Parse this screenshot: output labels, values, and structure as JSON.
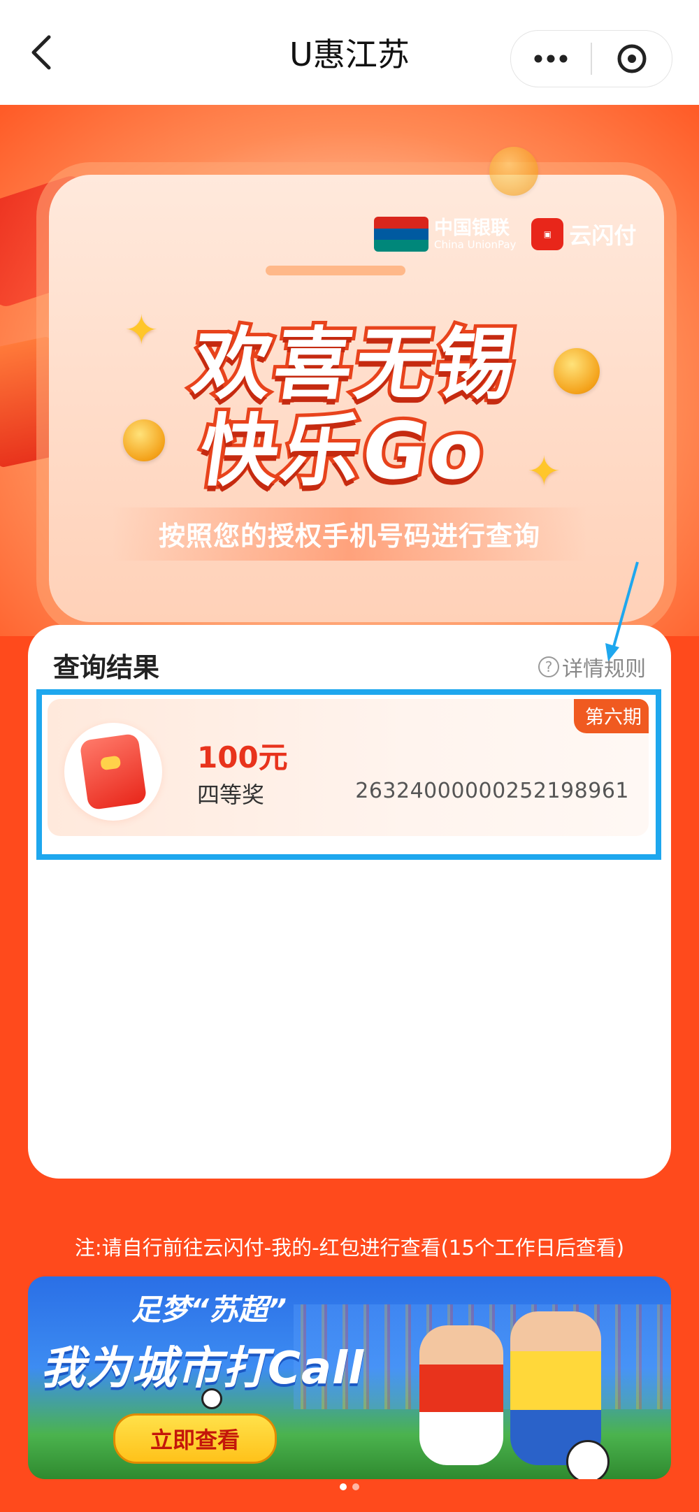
{
  "nav": {
    "title": "U惠江苏",
    "back_icon": "chevron-left-icon",
    "more_icon": "more-dots-icon",
    "close_icon": "close-circle-icon"
  },
  "banner": {
    "logo_unionpay_cn": "中国银联",
    "logo_unionpay_en": "China UnionPay",
    "logo_ysf": "云闪付",
    "headline_line1": "欢喜无锡",
    "headline_line2": "快乐Go",
    "subtitle": "按照您的授权手机号码进行查询"
  },
  "result": {
    "title": "查询结果",
    "rules_label": "详情规则",
    "items": [
      {
        "period": "第六期",
        "amount": "100元",
        "level": "四等奖",
        "code": "26324000000252198961"
      }
    ]
  },
  "note": "注:请自行前往云闪付-我的-红包进行查看(15个工作日后查看)",
  "promo": {
    "tag": "足梦“苏超”",
    "title": "我为城市打Call",
    "cta": "立即查看"
  },
  "carousel": {
    "count": 2,
    "active_index": 0
  },
  "colors": {
    "accent_red": "#ff4a1c",
    "prize_red": "#e8331c",
    "highlight_blue": "#1ea7ee",
    "badge_orange": "#f05a20"
  }
}
